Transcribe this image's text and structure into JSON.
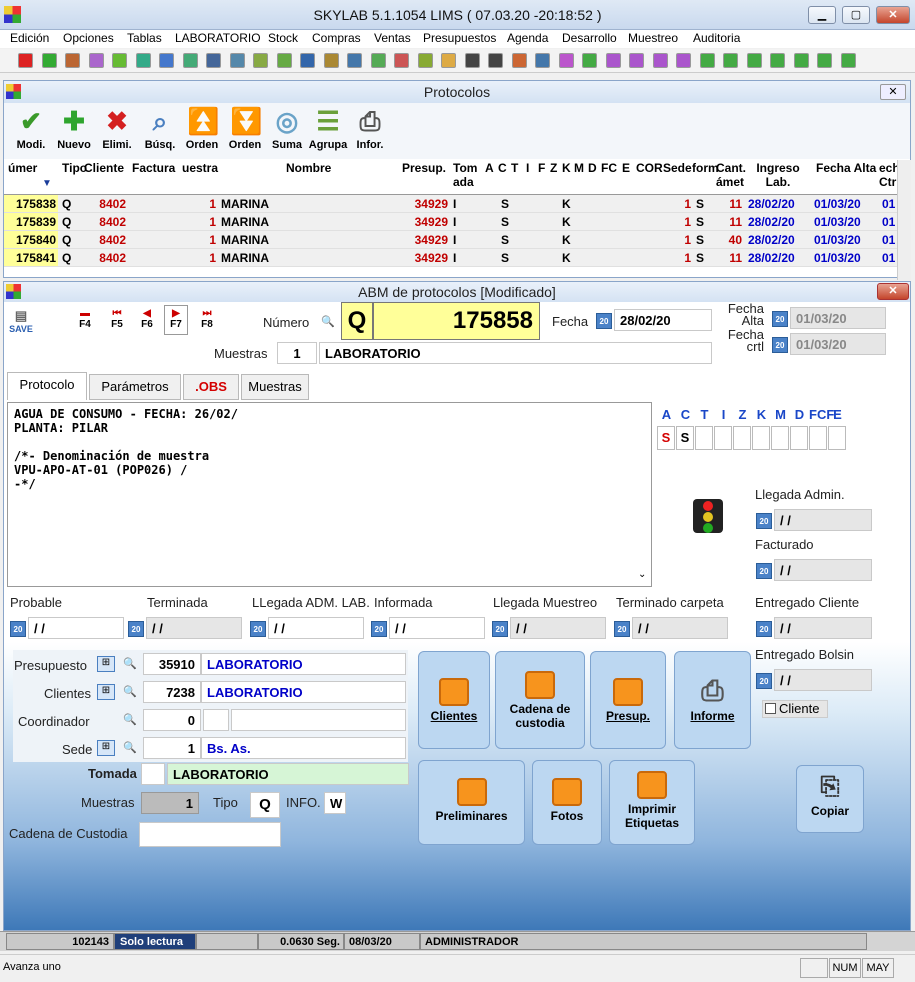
{
  "app": {
    "title": "SKYLAB 5.1.1054   LIMS   ( 07.03.20       -20:18:52 )",
    "min": "▁",
    "max": "▢",
    "close": "✕"
  },
  "menu": [
    "Edición",
    "Opciones",
    "Tablas",
    "LABORATORIO",
    "Stock",
    "Compras",
    "Ventas",
    "Presupuestos",
    "Agenda",
    "Desarrollo",
    "Muestreo",
    "Auditoria"
  ],
  "protocolos": {
    "title": "Protocolos",
    "close": "✕",
    "buttons": [
      {
        "label": "Modi."
      },
      {
        "label": "Nuevo"
      },
      {
        "label": "Elimi."
      },
      {
        "label": "Búsq."
      },
      {
        "label": "Orden"
      },
      {
        "label": "Orden"
      },
      {
        "label": "Suma"
      },
      {
        "label": "Agrupa"
      },
      {
        "label": "Infor."
      }
    ],
    "headers": [
      "úmer",
      "Tipo",
      "Cliente",
      "Factura",
      "uestra",
      "Nombre",
      "Presup.",
      "Tom ada",
      "A",
      "C",
      "T",
      "I",
      "F",
      "Z",
      "K",
      "M",
      "D",
      "FC",
      "E",
      "COR",
      "Sede",
      "form",
      "Cant. ámet",
      "Ingreso Lab.",
      "Fecha Alta",
      "ech Ctr"
    ],
    "rows": [
      {
        "num": "175838",
        "tipo": "Q",
        "cliente": "8402",
        "muestra": "1",
        "nombre": "MARINA",
        "presup": "34929",
        "tomada": "I",
        "c": "S",
        "k": "K",
        "sede": "1",
        "form": "S",
        "cant": "11",
        "ingreso": "28/02/20",
        "alta": "01/03/20",
        "ctr": "01"
      },
      {
        "num": "175839",
        "tipo": "Q",
        "cliente": "8402",
        "muestra": "1",
        "nombre": "MARINA",
        "presup": "34929",
        "tomada": "I",
        "c": "S",
        "k": "K",
        "sede": "1",
        "form": "S",
        "cant": "11",
        "ingreso": "28/02/20",
        "alta": "01/03/20",
        "ctr": "01"
      },
      {
        "num": "175840",
        "tipo": "Q",
        "cliente": "8402",
        "muestra": "1",
        "nombre": "MARINA",
        "presup": "34929",
        "tomada": "I",
        "c": "S",
        "k": "K",
        "sede": "1",
        "form": "S",
        "cant": "40",
        "ingreso": "28/02/20",
        "alta": "01/03/20",
        "ctr": "01"
      },
      {
        "num": "175841",
        "tipo": "Q",
        "cliente": "8402",
        "muestra": "1",
        "nombre": "MARINA",
        "presup": "34929",
        "tomada": "I",
        "c": "S",
        "k": "K",
        "sede": "1",
        "form": "S",
        "cant": "11",
        "ingreso": "28/02/20",
        "alta": "01/03/20",
        "ctr": "01"
      }
    ]
  },
  "abm": {
    "title": "ABM de protocolos  [Modificado]",
    "close": "✕",
    "nav": [
      "F4",
      "F5",
      "F6",
      "F7",
      "F8"
    ],
    "save": "SAVE",
    "numero_label": "Número",
    "tipo": "Q",
    "numero": "175858",
    "fecha_label": "Fecha",
    "fecha": "28/02/20",
    "fecha_alta_label": "Fecha Alta",
    "fecha_alta": "01/03/20",
    "fecha_crtl_label": "Fecha crtl",
    "fecha_crtl": "01/03/20",
    "muestras_label": "Muestras",
    "muestras_num": "1",
    "muestras_lab": "LABORATORIO",
    "tabs": [
      "Protocolo",
      "Parámetros",
      ".OBS",
      "Muestras"
    ],
    "text_lines": [
      "AGUA DE CONSUMO - FECHA: 26/02/",
      "PLANTA: PILAR",
      "",
      "/*- Denominación de muestra",
      "VPU-APO-AT-01 (POP026) /",
      "-*/"
    ],
    "flags_header": [
      "A",
      "C",
      "T",
      "I",
      "Z",
      "K",
      "M",
      "D",
      "FCF",
      "E"
    ],
    "flags_values": [
      "S",
      "S",
      "",
      "",
      "",
      "",
      "",
      "",
      "",
      ""
    ],
    "llegada_admin_label": "Llegada Admin.",
    "llegada_admin": " / /",
    "facturado_label": "Facturado",
    "facturado": " / /",
    "entregado_cliente_label": "Entregado Cliente",
    "entregado_cliente": " / /",
    "entregado_bolsin_label": "Entregado Bolsin",
    "entregado_bolsin": " / /",
    "cliente_check": "Cliente",
    "dates_row": [
      {
        "label": "Probable",
        "value": " / /"
      },
      {
        "label": "Terminada",
        "value": " / /"
      },
      {
        "label": "LLegada ADM. LAB.",
        "value": " / /"
      },
      {
        "label": "Informada",
        "value": " / /"
      },
      {
        "label": "Llegada  Muestreo",
        "value": " / /"
      },
      {
        "label": "Terminado carpeta",
        "value": " / /"
      }
    ],
    "presupuesto_label": "Presupuesto",
    "presupuesto": "35910",
    "presupuesto_name": "LABORATORIO",
    "clientes_label": "Clientes",
    "clientes": "7238",
    "clientes_name": "LABORATORIO",
    "coordinador_label": "Coordinador",
    "coordinador": "0",
    "sede_label": "Sede",
    "sede": "1",
    "sede_name": "Bs. As.",
    "tomada_label": "Tomada",
    "tomada": "LABORATORIO",
    "muestras2_label": "Muestras",
    "muestras2": "1",
    "tipo_label": "Tipo",
    "tipo_val": "Q",
    "info_label": "INFO.",
    "info_val": "W",
    "cadena_label": "Cadena de Custodia",
    "actions": {
      "clientes": "Clientes",
      "cadena": "Cadena de custodia",
      "presup": "Presup.",
      "informe": "Informe",
      "preliminares": "Preliminares",
      "fotos": "Fotos",
      "imprimir": "Imprimir Etiquetas",
      "copiar": "Copiar"
    }
  },
  "status": {
    "id": "102143",
    "mode": "Solo lectura",
    "time": "0.0630 Seg.",
    "date": "08/03/20",
    "user": "ADMINISTRADOR"
  },
  "bottom": {
    "left": "Avanza uno",
    "num": "NUM",
    "may": "MAY"
  }
}
